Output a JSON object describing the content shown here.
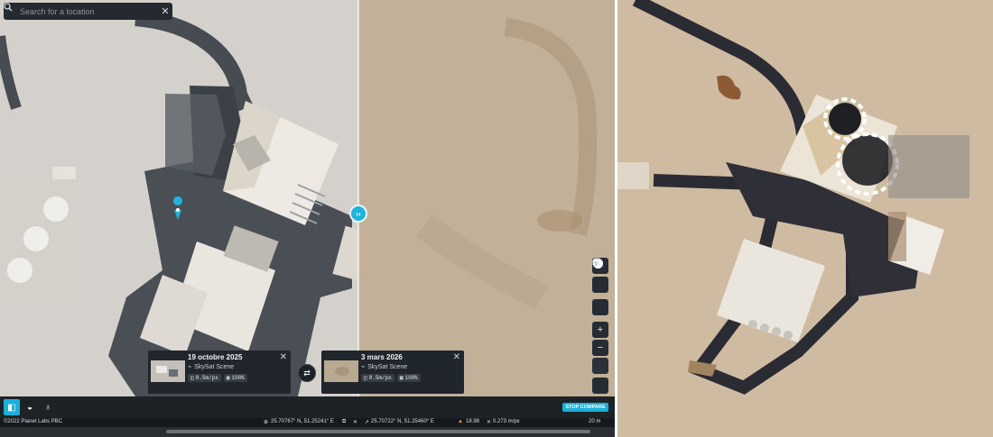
{
  "search": {
    "placeholder": "Search for a location"
  },
  "compare": {
    "left": {
      "date": "19 octobre 2025",
      "source": "SkySat Scene",
      "resolution": "0.5m/px",
      "coverage": "100%"
    },
    "right": {
      "date": "3 mars 2026",
      "source": "SkySat Scene",
      "resolution": "0.5m/px",
      "coverage": "100%"
    }
  },
  "stop_compare": "STOP COMPARE",
  "status": {
    "copyright": "©2022 Planet Labs PBC",
    "coord_a": "25.70767° N, 51.25241° E",
    "coord_b": "25.70722° N, 51.25460° E",
    "distance": "18.98",
    "scale": "0.273 m/px",
    "scale_bar": "20 m"
  },
  "icons": [
    "search-icon",
    "close-icon",
    "link-icon",
    "ruler-icon",
    "layers-icon",
    "zoom-in-icon",
    "zoom-out-icon",
    "globe-icon",
    "search-zoom-icon",
    "compare-icon",
    "contrast-icon",
    "lightbulb-icon",
    "swap-icon",
    "location-pin-icon",
    "warning-icon"
  ],
  "colors": {
    "accent": "#1fb3dd",
    "panel": "#20262c",
    "warning": "#f0a020"
  }
}
